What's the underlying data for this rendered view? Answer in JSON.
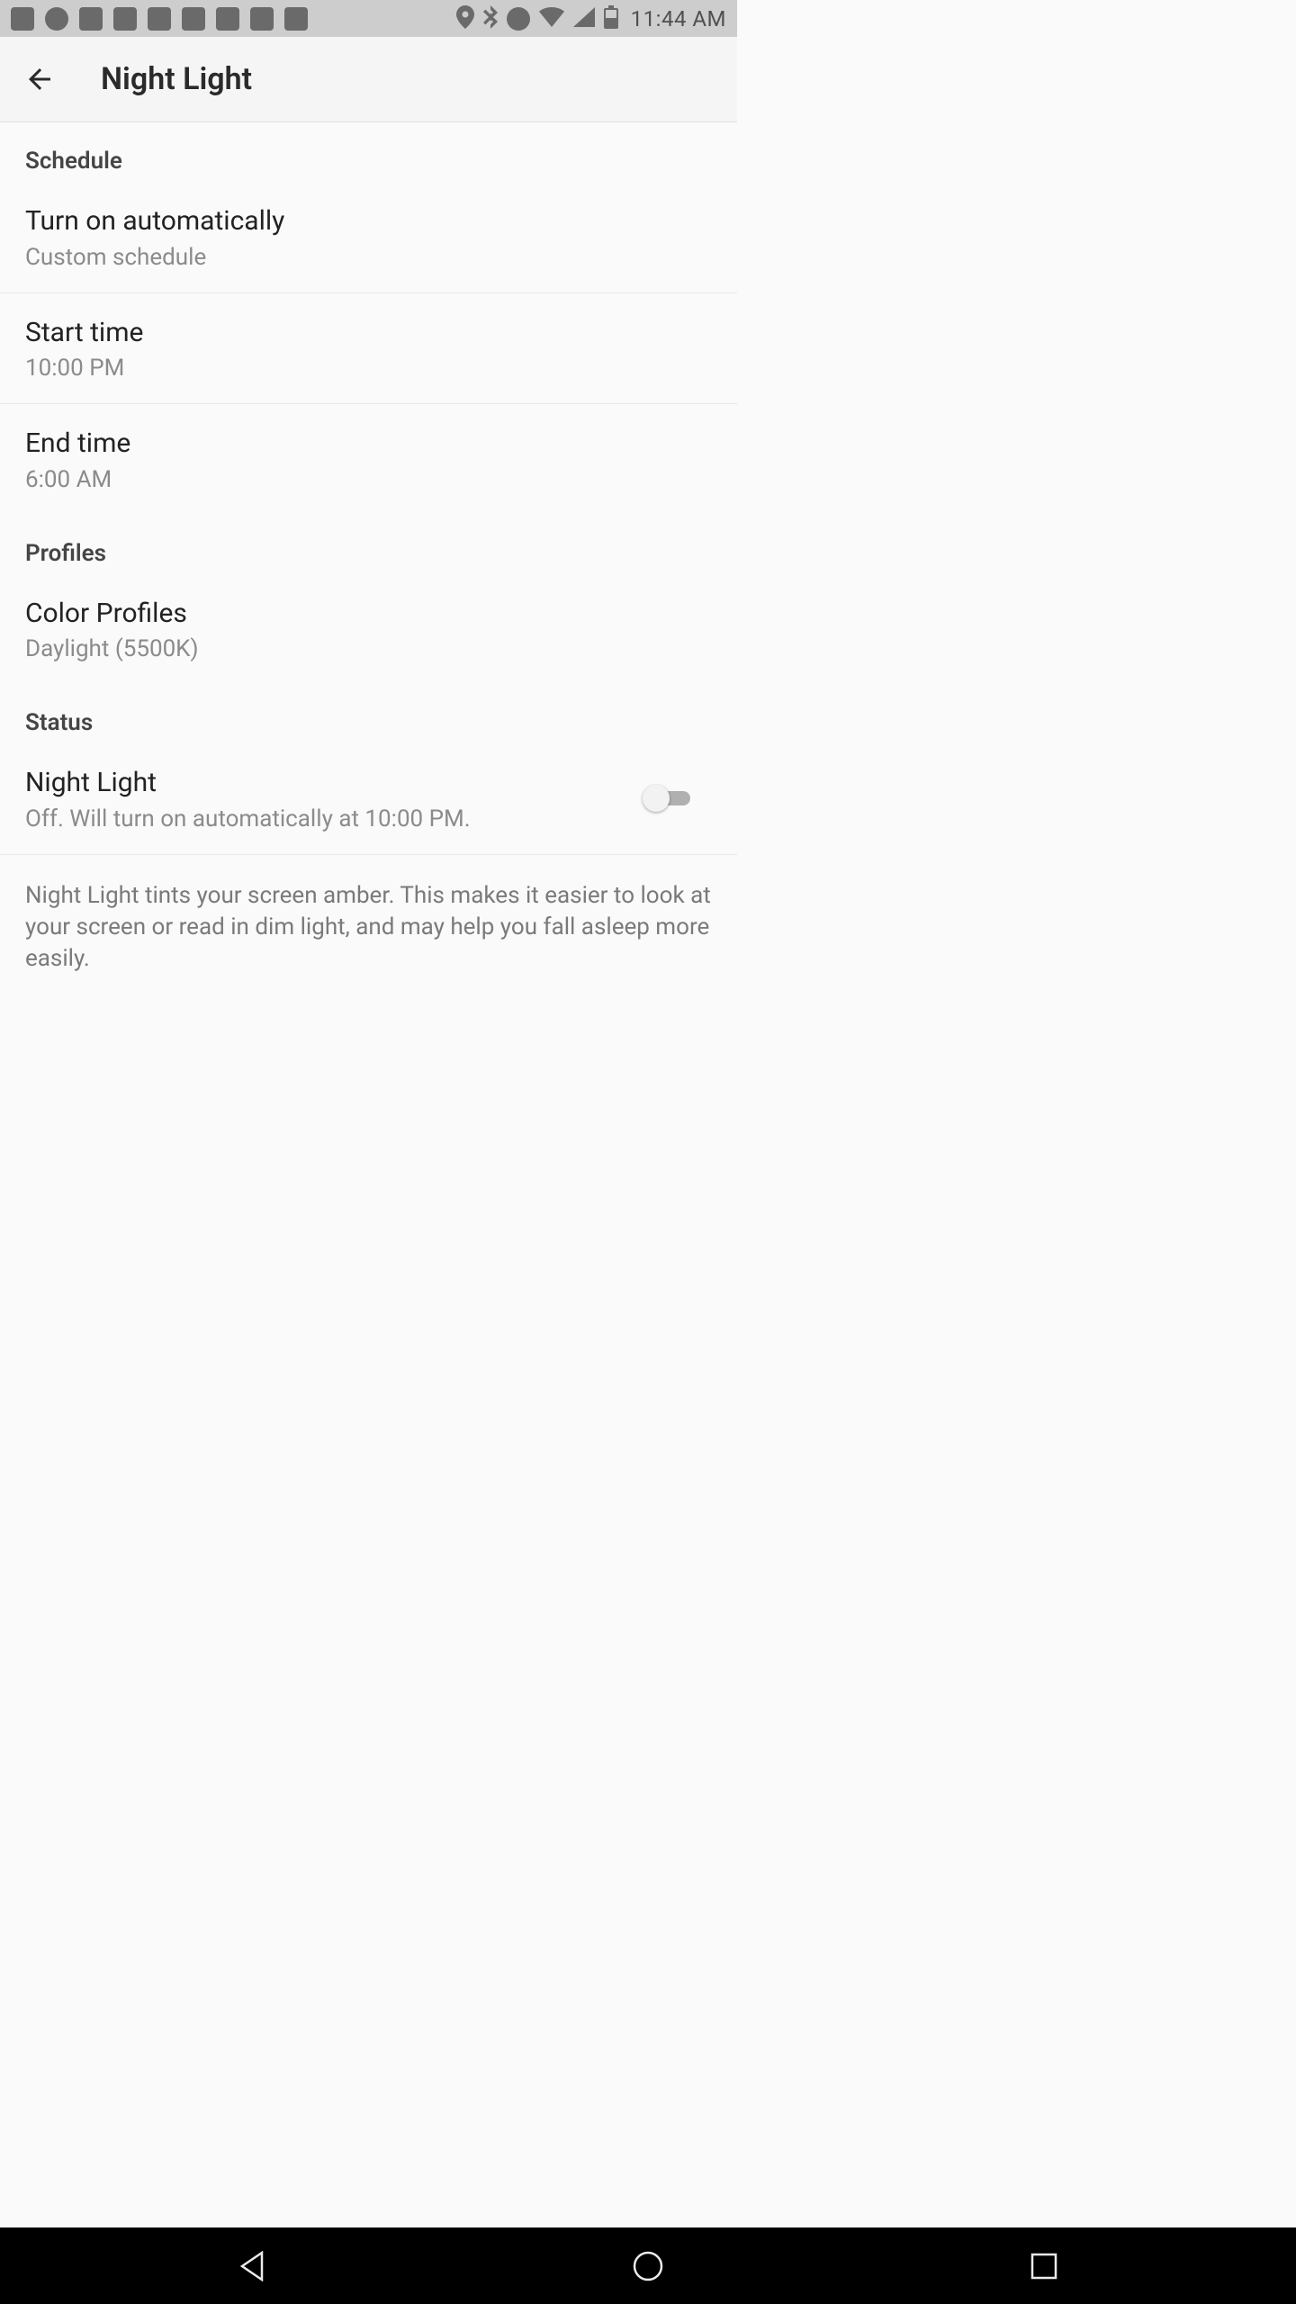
{
  "status_bar": {
    "time": "11:44 AM"
  },
  "app_bar": {
    "title": "Night Light"
  },
  "sections": {
    "schedule": {
      "header": "Schedule",
      "turn_on_auto": {
        "title": "Turn on automatically",
        "summary": "Custom schedule"
      },
      "start_time": {
        "title": "Start time",
        "summary": "10:00 PM"
      },
      "end_time": {
        "title": "End time",
        "summary": "6:00 AM"
      }
    },
    "profiles": {
      "header": "Profiles",
      "color_profiles": {
        "title": "Color Profiles",
        "summary": "Daylight (5500K)"
      }
    },
    "status": {
      "header": "Status",
      "night_light": {
        "title": "Night Light",
        "summary": "Off. Will turn on automatically at 10:00 PM.",
        "enabled": false
      },
      "description": "Night Light tints your screen amber. This makes it easier to look at your screen or read in dim light, and may help you fall asleep more easily."
    }
  }
}
